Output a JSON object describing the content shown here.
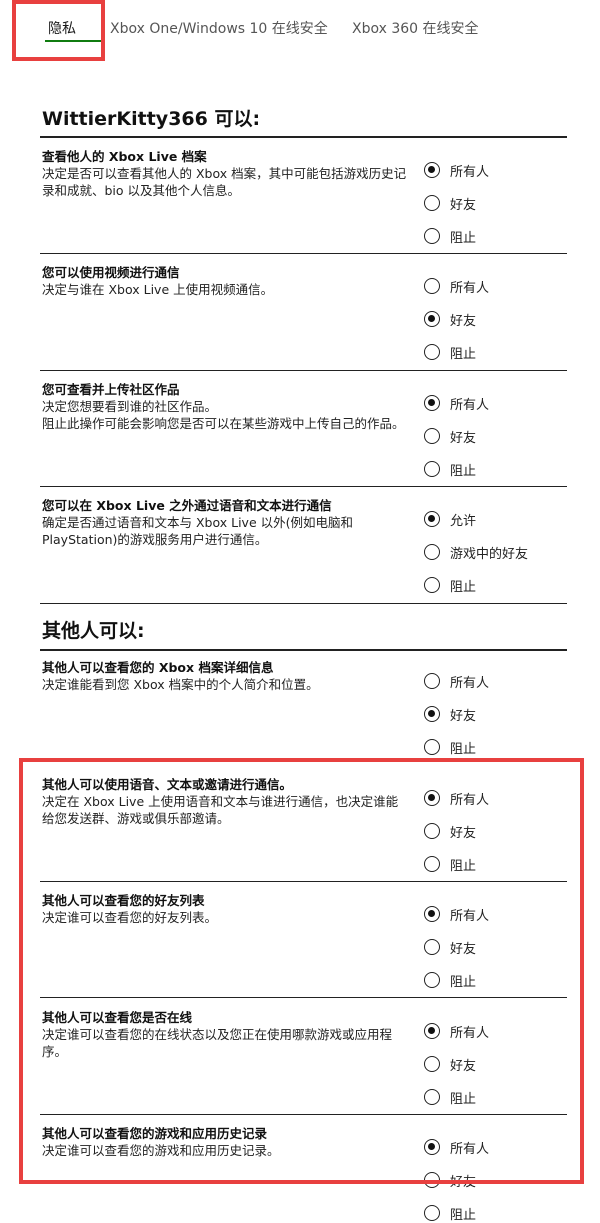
{
  "tabs": [
    {
      "label": "隐私",
      "active": true
    },
    {
      "label": "Xbox One/Windows 10 在线安全",
      "active": false
    },
    {
      "label": "Xbox 360 在线安全",
      "active": false
    }
  ],
  "section_you": {
    "heading": "WittierKitty366 可以:"
  },
  "section_others": {
    "heading": "其他人可以:"
  },
  "settings": [
    {
      "title": "查看他人的 Xbox Live 档案",
      "desc": "决定是否可以查看其他人的 Xbox 档案，其中可能包括游戏历史记录和成就、bio 以及其他个人信息。",
      "options": [
        "所有人",
        "好友",
        "阻止"
      ],
      "selected": 0
    },
    {
      "title": "您可以使用视频进行通信",
      "desc": "决定与谁在 Xbox Live 上使用视频通信。",
      "options": [
        "所有人",
        "好友",
        "阻止"
      ],
      "selected": 1
    },
    {
      "title": "您可查看并上传社区作品",
      "desc": "决定您想要看到谁的社区作品。\n阻止此操作可能会影响您是否可以在某些游戏中上传自己的作品。",
      "options": [
        "所有人",
        "好友",
        "阻止"
      ],
      "selected": 0
    },
    {
      "title": "您可以在 Xbox Live 之外通过语音和文本进行通信",
      "desc": "确定是否通过语音和文本与 Xbox Live 以外(例如电脑和 PlayStation)的游戏服务用户进行通信。",
      "options": [
        "允许",
        "游戏中的好友",
        "阻止"
      ],
      "selected": 0
    },
    {
      "title": "其他人可以查看您的 Xbox 档案详细信息",
      "desc": "决定谁能看到您 Xbox 档案中的个人简介和位置。",
      "options": [
        "所有人",
        "好友",
        "阻止"
      ],
      "selected": 1
    },
    {
      "title": "其他人可以使用语音、文本或邀请进行通信。",
      "desc": "决定在 Xbox Live 上使用语音和文本与谁进行通信，也决定谁能给您发送群、游戏或俱乐部邀请。",
      "options": [
        "所有人",
        "好友",
        "阻止"
      ],
      "selected": 0
    },
    {
      "title": "其他人可以查看您的好友列表",
      "desc": "决定谁可以查看您的好友列表。",
      "options": [
        "所有人",
        "好友",
        "阻止"
      ],
      "selected": 0
    },
    {
      "title": "其他人可以查看您是否在线",
      "desc": "决定谁可以查看您的在线状态以及您正在使用哪款游戏或应用程序。",
      "options": [
        "所有人",
        "好友",
        "阻止"
      ],
      "selected": 0
    },
    {
      "title": "其他人可以查看您的游戏和应用历史记录",
      "desc": "决定谁可以查看您的游戏和应用历史记录。",
      "options": [
        "所有人",
        "好友",
        "阻止"
      ],
      "selected": 0
    }
  ]
}
